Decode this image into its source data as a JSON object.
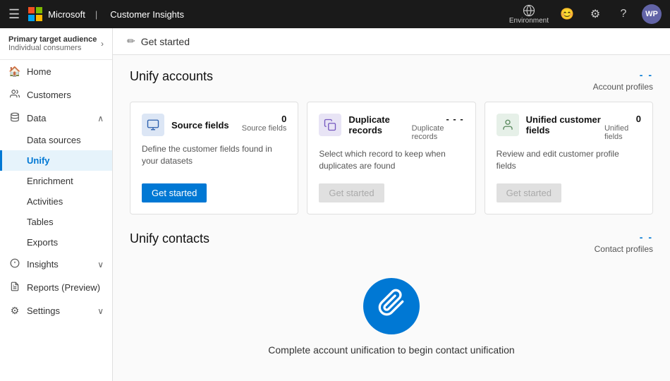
{
  "topnav": {
    "app_title": "Customer Insights",
    "env_label": "Environment",
    "avatar_initials": "WP"
  },
  "sidebar": {
    "audience_label": "Primary target audience",
    "audience_sub": "Individual consumers",
    "items": [
      {
        "id": "home",
        "label": "Home",
        "icon": "🏠"
      },
      {
        "id": "customers",
        "label": "Customers",
        "icon": "👤"
      },
      {
        "id": "data",
        "label": "Data",
        "icon": "📊",
        "expanded": true
      },
      {
        "id": "data-sources",
        "label": "Data sources",
        "sub": true
      },
      {
        "id": "unify",
        "label": "Unify",
        "sub": true,
        "active": true
      },
      {
        "id": "enrichment",
        "label": "Enrichment",
        "sub": true
      },
      {
        "id": "activities",
        "label": "Activities",
        "sub": true
      },
      {
        "id": "tables",
        "label": "Tables",
        "sub": true
      },
      {
        "id": "exports",
        "label": "Exports",
        "sub": true
      },
      {
        "id": "insights",
        "label": "Insights",
        "icon": "💡",
        "expand": true
      },
      {
        "id": "reports",
        "label": "Reports (Preview)",
        "icon": "📋"
      },
      {
        "id": "settings",
        "label": "Settings",
        "icon": "⚙️",
        "expand": true
      }
    ]
  },
  "header": {
    "breadcrumb": "Get started"
  },
  "accounts_section": {
    "title": "Unify accounts",
    "meta_dashes": "- -",
    "meta_label": "Account profiles",
    "cards": [
      {
        "id": "source-fields",
        "title": "Source fields",
        "count_num": "0",
        "count_label": "Source fields",
        "desc": "Define the customer fields found in your datasets",
        "action_label": "Get started",
        "action_disabled": false
      },
      {
        "id": "duplicate-records",
        "title": "Duplicate records",
        "count_num": "- - -",
        "count_label": "Duplicate records",
        "desc": "Select which record to keep when duplicates are found",
        "action_label": "Get started",
        "action_disabled": true
      },
      {
        "id": "unified-customer-fields",
        "title": "Unified customer fields",
        "count_num": "0",
        "count_label": "Unified fields",
        "desc": "Review and edit customer profile fields",
        "action_label": "Get started",
        "action_disabled": true
      }
    ]
  },
  "contacts_section": {
    "title": "Unify contacts",
    "meta_dashes": "- -",
    "meta_label": "Contact profiles",
    "empty_msg": "Complete account unification to begin contact unification"
  }
}
